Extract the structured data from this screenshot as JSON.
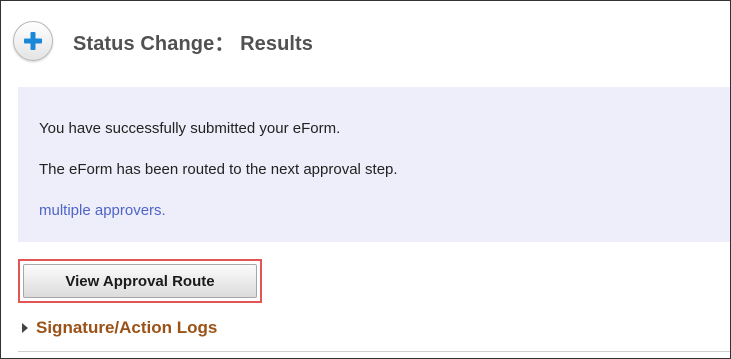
{
  "header": {
    "icon": "plus-icon",
    "title": "Status Change： Results"
  },
  "message": {
    "line1": "You have successfully submitted your eForm.",
    "line2": "The eForm has been routed to the next approval step.",
    "line3": "multiple approvers."
  },
  "actions": {
    "view_route_label": "View Approval Route"
  },
  "logs": {
    "icon": "caret-right-icon",
    "label": "Signature/Action Logs"
  },
  "colors": {
    "title_text": "#515151",
    "message_bg": "#eeeefb",
    "link": "#4e64c8",
    "highlight_border": "#e25555",
    "logs_label": "#9a5216",
    "plus_icon": "#1a88d8"
  }
}
